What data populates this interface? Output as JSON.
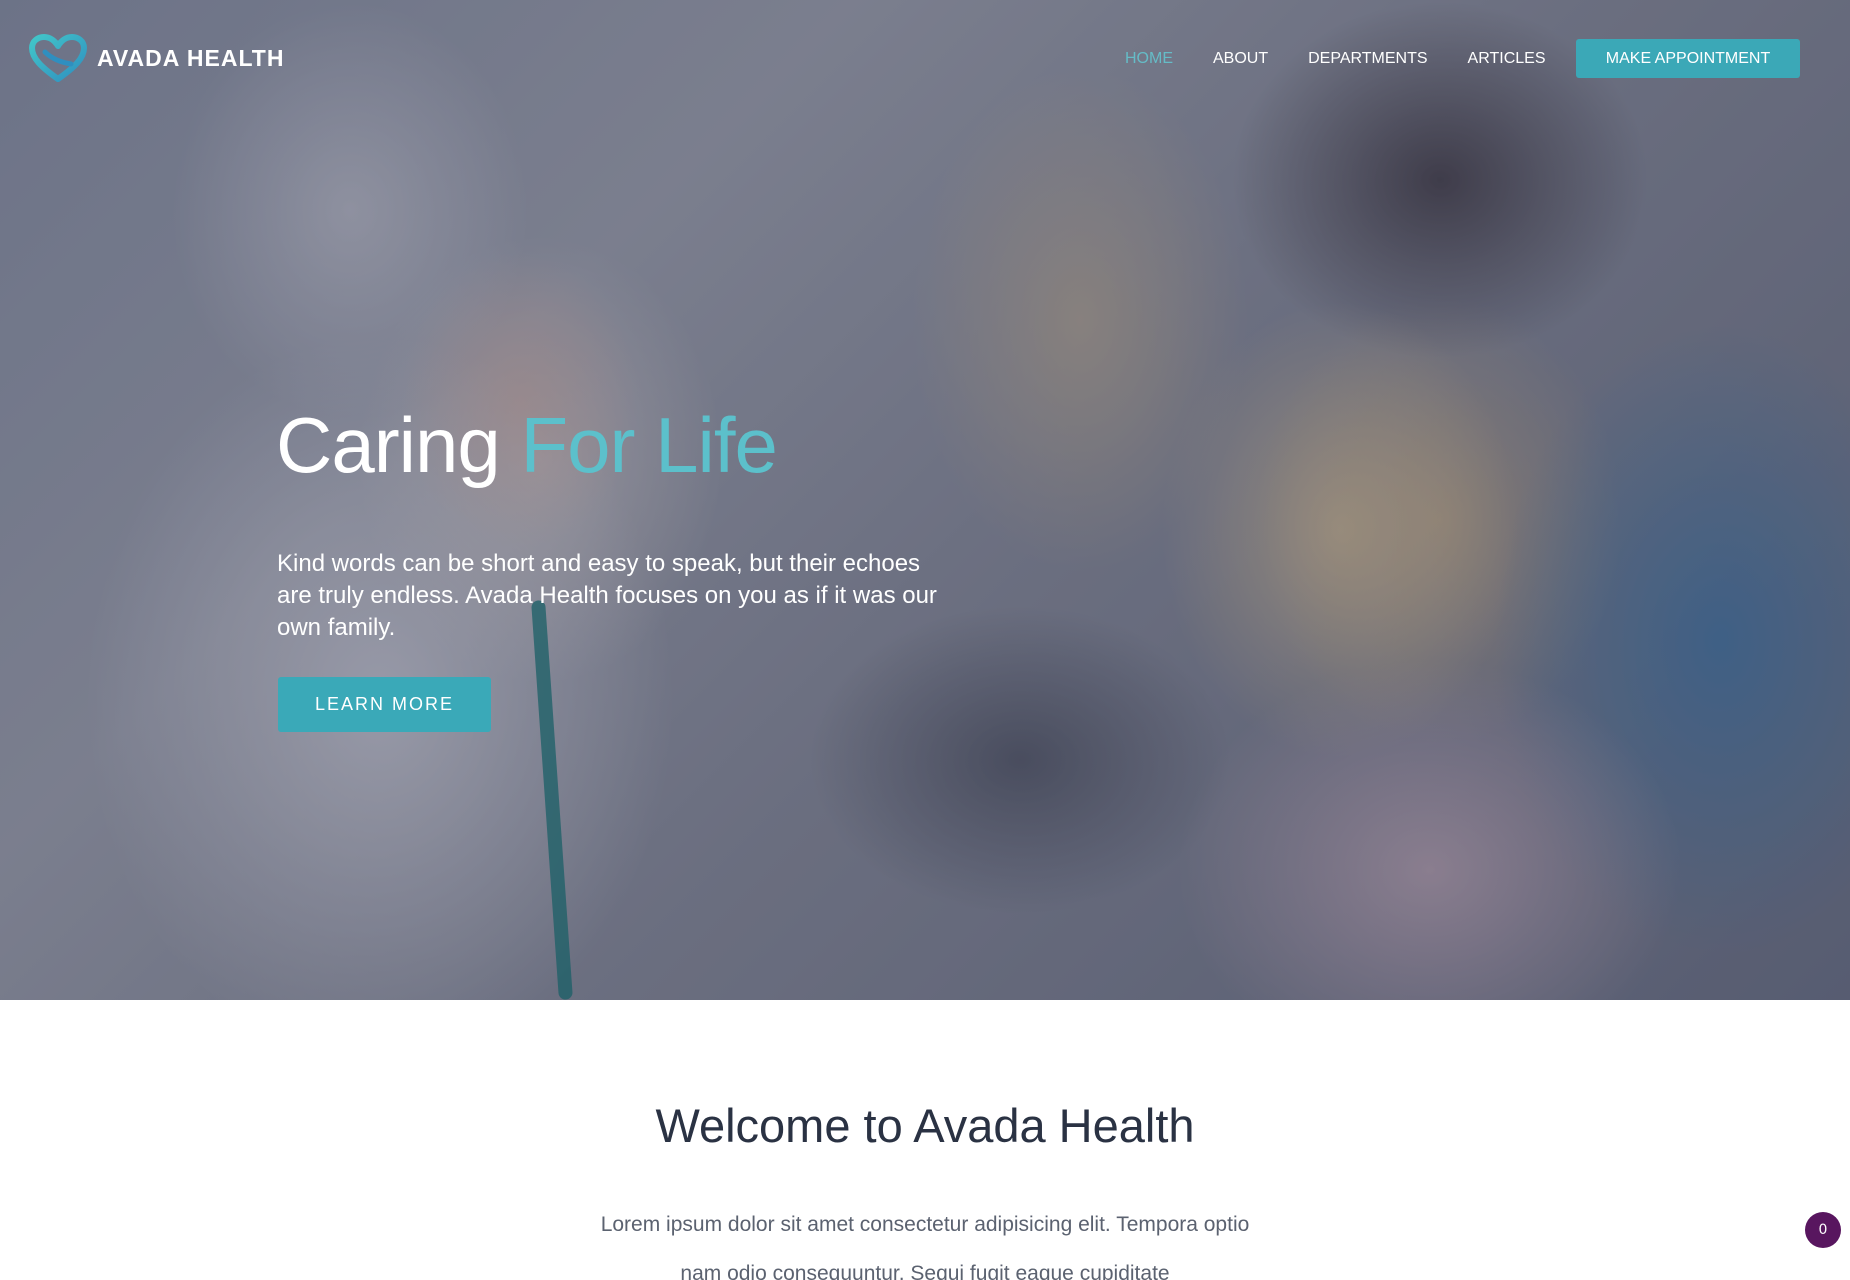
{
  "brand": {
    "name": "AVADA HEALTH",
    "logo_icon": "heart-logo-icon",
    "accent": "#3ba8b7"
  },
  "nav": {
    "items": [
      {
        "label": "HOME",
        "active": true
      },
      {
        "label": "ABOUT",
        "active": false
      },
      {
        "label": "DEPARTMENTS",
        "active": false
      },
      {
        "label": "ARTICLES",
        "active": false
      }
    ],
    "cta_label": "MAKE APPOINTMENT"
  },
  "hero": {
    "title_main": "Caring ",
    "title_accent": "For Life",
    "text": "Kind words can be short and easy to speak, but their echoes are truly endless. Avada Health focuses on you as if it was our own family.",
    "button_label": "LEARN MORE"
  },
  "welcome": {
    "title": "Welcome to Avada Health",
    "text": "Lorem ipsum dolor sit amet consectetur adipisicing elit. Tempora optio nam odio consequuntur. Sequi fugit eaque cupiditate"
  },
  "badge": {
    "count": "0"
  }
}
